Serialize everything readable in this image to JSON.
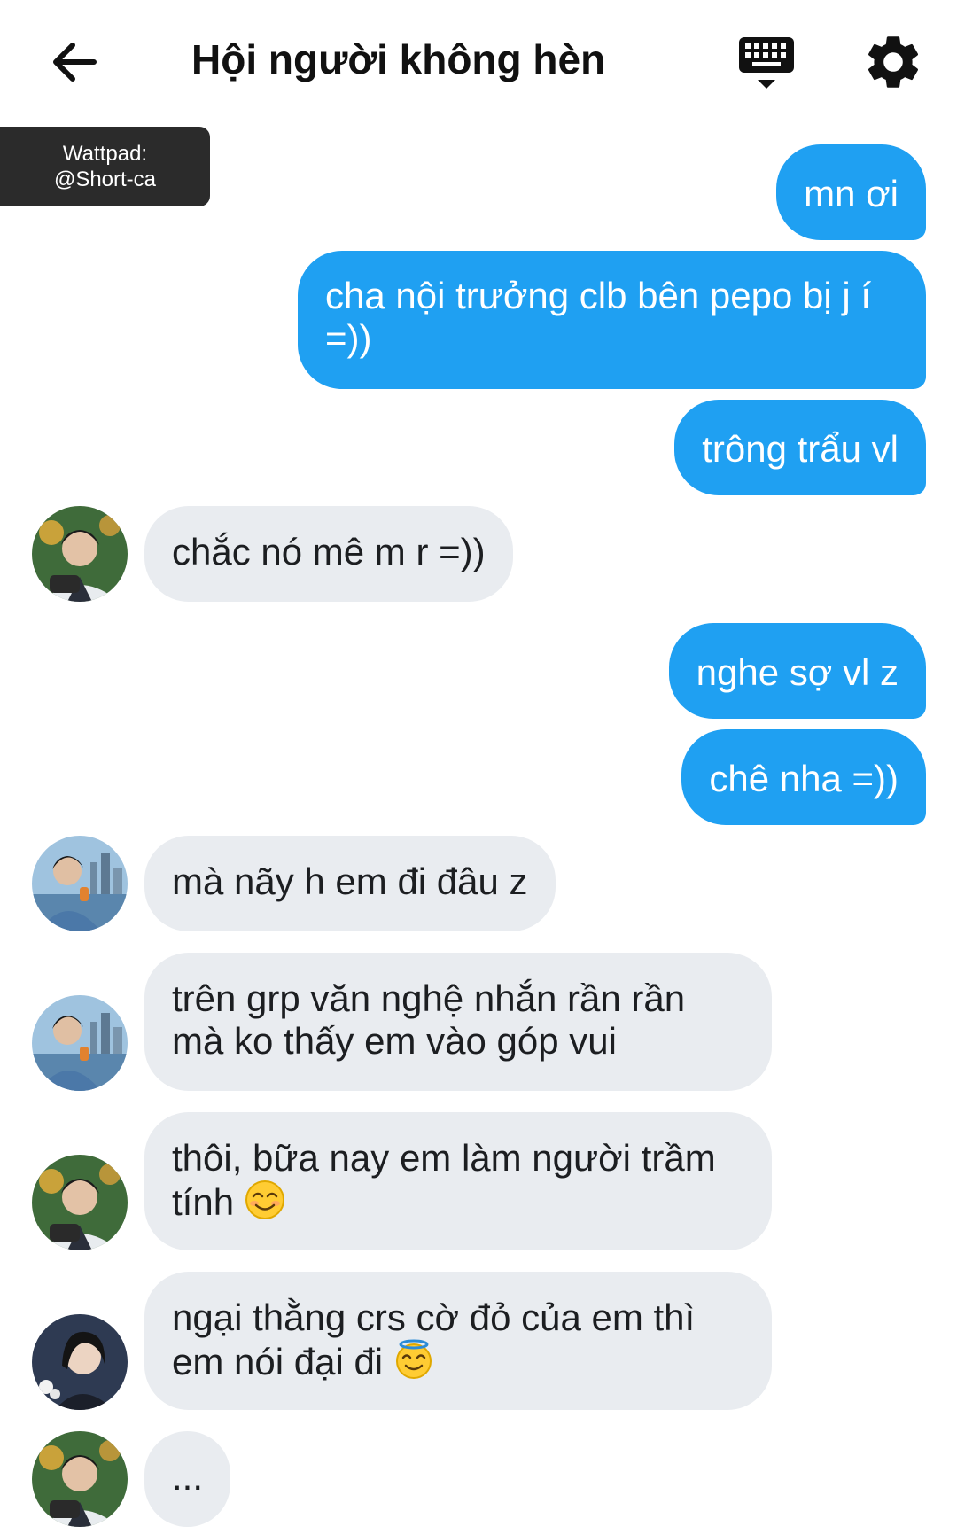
{
  "header": {
    "title": "Hội người không hèn"
  },
  "watermark": {
    "line1": "Wattpad:",
    "line2": "@Short-ca"
  },
  "messages": [
    {
      "from": "me",
      "text": "mn ơi"
    },
    {
      "from": "me",
      "text": "cha nội trưởng clb bên pepo bị j í =))"
    },
    {
      "from": "me",
      "text": "trông trẩu vl"
    },
    {
      "from": "other",
      "avatar": "avatar-1",
      "text": "chắc nó mê m r =))"
    },
    {
      "from": "me",
      "text": "nghe sợ vl z"
    },
    {
      "from": "me",
      "text": "chê nha =))"
    },
    {
      "from": "other",
      "avatar": "avatar-2",
      "text": "mà nãy h em đi đâu z"
    },
    {
      "from": "other",
      "avatar": "avatar-2",
      "text": "trên grp văn nghệ nhắn rần rần mà ko thấy em vào góp vui"
    },
    {
      "from": "other",
      "avatar": "avatar-1",
      "text": "thôi, bữa nay em làm người trầm tính",
      "emoji": "smiling-face"
    },
    {
      "from": "other",
      "avatar": "avatar-3",
      "text": "ngại thằng crs cờ đỏ của em thì em nói đại đi",
      "emoji": "halo-face"
    },
    {
      "from": "other",
      "avatar": "avatar-1",
      "text": "..."
    }
  ],
  "colors": {
    "outgoing_bubble": "#1fa0f2",
    "incoming_bubble": "#e9ecf0",
    "watermark_bg": "#2b2b2b"
  },
  "icons": [
    "back-arrow-icon",
    "keyboard-icon",
    "gear-icon"
  ]
}
